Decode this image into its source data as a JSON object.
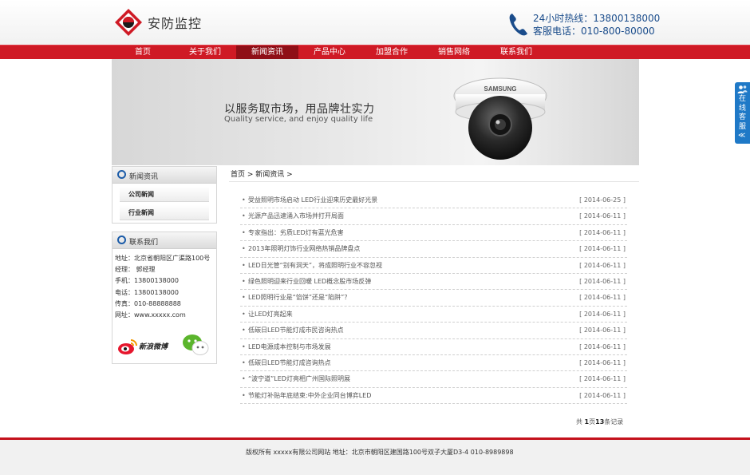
{
  "header": {
    "logo_text": "安防监控",
    "hotline_label": "24小时热线：",
    "hotline_number": "13800138000",
    "service_label": "客服电话：",
    "service_number": "010-800-80000"
  },
  "nav": {
    "items": [
      "首页",
      "关于我们",
      "新闻资讯",
      "产品中心",
      "加盟合作",
      "销售网络",
      "联系我们"
    ],
    "active_index": 2
  },
  "banner": {
    "title": "以服务取市场，用品牌壮实力",
    "subtitle": "Quality service, and enjoy quality life",
    "brand": "SAMSUNG"
  },
  "sidebar": {
    "news": {
      "title": "新闻资讯",
      "items": [
        "公司新闻",
        "行业新闻"
      ]
    },
    "contact": {
      "title": "联系我们",
      "lines": [
        "地址：北京省朝阳区广渠路100号",
        "经理： 郭经理",
        "手机：13800138000",
        "电话：13800138000",
        "传真：010-88888888",
        "网址：www.xxxxx.com"
      ],
      "weibo_label": "新浪微博"
    }
  },
  "breadcrumb": "首页 > 新闻资讯 >",
  "news_list": [
    {
      "title": "受益照明市场启动 LED行业迎来历史最好光景",
      "date": "[ 2014-06-25 ]"
    },
    {
      "title": "光源产品迅速涌入市场并打开局面",
      "date": "[ 2014-06-11 ]"
    },
    {
      "title": "专家指出：劣质LED灯有蓝光危害",
      "date": "[ 2014-06-11 ]"
    },
    {
      "title": "2013年照明灯饰行业网络热销品牌盘点",
      "date": "[ 2014-06-11 ]"
    },
    {
      "title": "LED日光管“别有洞天”，将成照明行业不容忽视",
      "date": "[ 2014-06-11 ]"
    },
    {
      "title": "绿色照明迎来行业回暖 LED概念股市场反弹",
      "date": "[ 2014-06-11 ]"
    },
    {
      "title": "LED照明行业是“馅饼”还是“陷阱”？",
      "date": "[ 2014-06-11 ]"
    },
    {
      "title": "让LED灯亮起来",
      "date": "[ 2014-06-11 ]"
    },
    {
      "title": "低碳日LED节能灯成市民咨询热点",
      "date": "[ 2014-06-11 ]"
    },
    {
      "title": "LED电源成本控制与市场发展",
      "date": "[ 2014-06-11 ]"
    },
    {
      "title": "低碳日LED节能灯成咨询热点",
      "date": "[ 2014-06-11 ]"
    },
    {
      "title": "“波宁道”LED灯亮相广州国际照明展",
      "date": "[ 2014-06-11 ]"
    },
    {
      "title": "节能灯补贴年底结束:中外企业同台博弈LED",
      "date": "[ 2014-06-11 ]"
    }
  ],
  "pager": {
    "prefix": "共",
    "page": "1",
    "mid": "页",
    "count": "13",
    "suffix": "条记录"
  },
  "footer": {
    "text": "版权所有 xxxxx有限公司网站 地址：北京市朝阳区建国路100号双子大厦D3-4 010-8989898"
  },
  "service_tab": {
    "text": "在线客服",
    "arrow": "≪"
  },
  "colors": {
    "brand_red": "#cf1a25",
    "nav_active": "#8f0f17",
    "hotline_blue": "#1a4c8b",
    "service_blue": "#1f79c7"
  }
}
